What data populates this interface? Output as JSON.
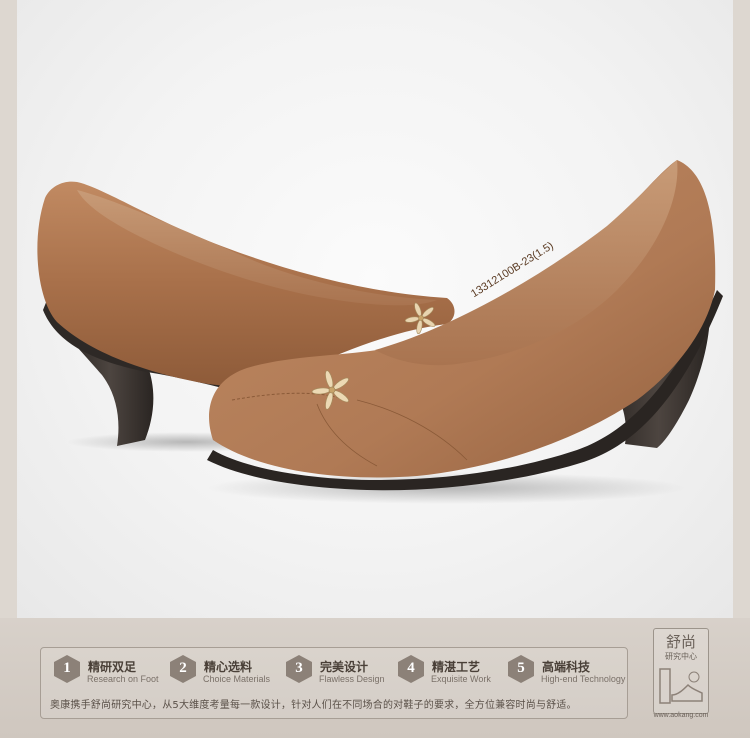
{
  "product": {
    "style_code": "13312100B-23(1.5)"
  },
  "features": [
    {
      "number": "1",
      "title_zh": "精研双足",
      "title_en": "Research on Foot"
    },
    {
      "number": "2",
      "title_zh": "精心选料",
      "title_en": "Choice Materials"
    },
    {
      "number": "3",
      "title_zh": "完美设计",
      "title_en": "Flawless Design"
    },
    {
      "number": "4",
      "title_zh": "精湛工艺",
      "title_en": "Exquisite Work"
    },
    {
      "number": "5",
      "title_zh": "高端科技",
      "title_en": "High-end Technology"
    }
  ],
  "description": "奥康携手舒尚研究中心，从5大维度考量每一款设计，针对人们在不同场合的对鞋子的要求，全方位兼容时尚与舒适。",
  "logo": {
    "name_zh": "舒尚",
    "subtitle_zh": "研究中心",
    "url": "www.aokang.com"
  },
  "colors": {
    "leather": "#b07a55",
    "heel": "#3a3430",
    "band": "#d6cfc7",
    "badge": "#8c8178"
  }
}
